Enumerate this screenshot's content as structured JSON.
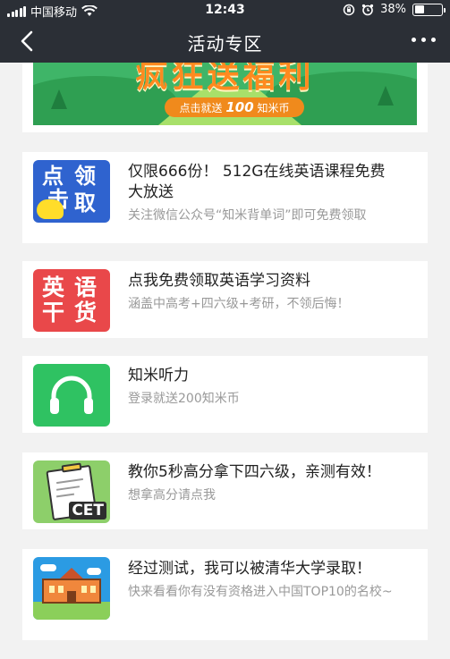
{
  "status_bar": {
    "carrier": "中国移动",
    "time": "12:43",
    "battery": "38%",
    "battery_level": 0.38
  },
  "nav": {
    "title": "活动专区"
  },
  "banner": {
    "headline": "疯狂送福利",
    "pill_prefix": "点击就送",
    "pill_number": "100",
    "pill_suffix": "知米币"
  },
  "items": [
    {
      "icon_text": [
        "点",
        "领",
        "击",
        "取"
      ],
      "title": "仅限666份！ 512G在线英语课程免费大放送",
      "subtitle": "关注微信公众号“知米背单词”即可免费领取"
    },
    {
      "icon_text": [
        "英",
        "语",
        "干",
        "货"
      ],
      "title": "点我免费领取英语学习资料",
      "subtitle": "涵盖中高考+四六级+考研，不领后悔！"
    },
    {
      "icon": "headphones-icon",
      "title": "知米听力",
      "subtitle": "登录就送200知米币"
    },
    {
      "icon_text": [
        "CET"
      ],
      "title": "教你5秒高分拿下四六级，亲测有效！",
      "subtitle": "想拿高分请点我"
    },
    {
      "icon": "school-building-icon",
      "title": "经过测试，我可以被清华大学录取！",
      "subtitle": "快来看看你有没有资格进入中国TOP10的名校~"
    }
  ]
}
